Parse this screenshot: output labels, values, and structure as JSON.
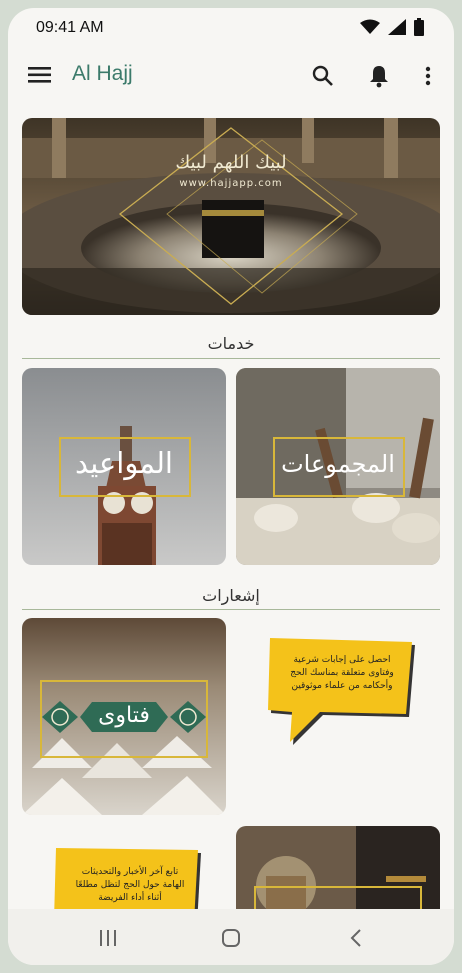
{
  "status_bar": {
    "time": "09:41 AM"
  },
  "app_bar": {
    "title": "Al Hajj"
  },
  "banner": {
    "arabic_text": "لبيك اللهم لبيك",
    "website": "www.hajjapp.com"
  },
  "services": {
    "title": "خدمات",
    "cards": [
      {
        "label": "المواعيد"
      },
      {
        "label": "المجموعات"
      }
    ]
  },
  "notifications": {
    "title": "إشعارات",
    "cards": [
      {
        "label": "فتاوى"
      },
      {
        "bubble_text": "احصل على إجابات شرعية وفتاوى متعلقة بمناسك الحج وأحكامه من علماء موثوقين"
      },
      {
        "bubble_text": "تابع آخر الأخبار والتحديثات الهامة حول الحج لتظل مطلعًا أثناء أداء الفريضة"
      },
      {
        "label": ""
      }
    ]
  },
  "colors": {
    "accent": "#3b7a6a",
    "frame_gold": "#d8b73a",
    "bubble_yellow": "#f4c21a"
  }
}
